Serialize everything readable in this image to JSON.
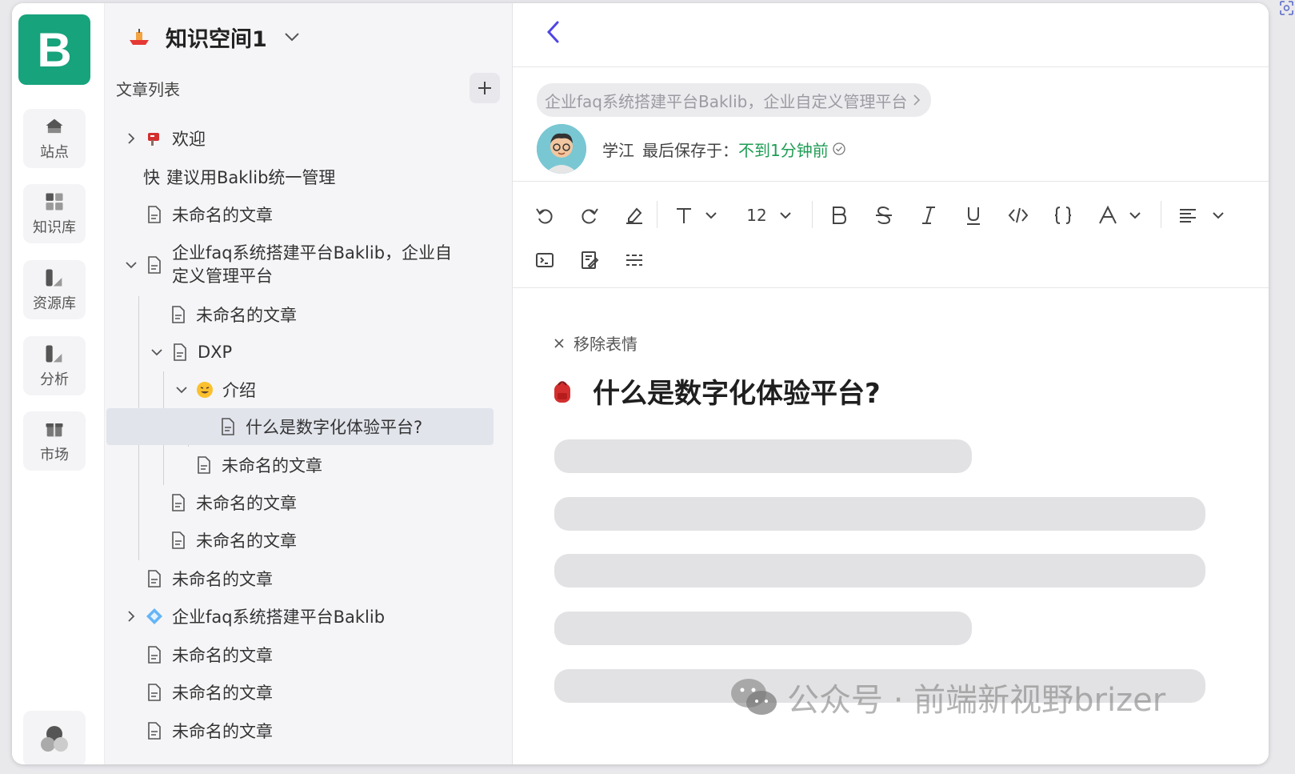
{
  "rail": {
    "logo": "B",
    "items": [
      {
        "label": "站点",
        "icon": "home-icon"
      },
      {
        "label": "知识库",
        "icon": "grid-icon"
      },
      {
        "label": "资源库",
        "icon": "resource-icon"
      },
      {
        "label": "分析",
        "icon": "analytics-icon"
      },
      {
        "label": "市场",
        "icon": "gift-icon"
      }
    ]
  },
  "sidebar": {
    "space_title": "知识空间1",
    "list_title": "文章列表",
    "tree": [
      {
        "label": "欢迎",
        "icon": "mailbox-icon"
      },
      {
        "prefix": "快",
        "label": "建议用Baklib统一管理"
      },
      {
        "label": "未命名的文章"
      },
      {
        "label_line1": "企业faq系统搭建平台Baklib，企业自",
        "label_line2": "定义管理平台"
      },
      {
        "label": "未命名的文章"
      },
      {
        "label": "DXP"
      },
      {
        "label": "介绍",
        "icon": "grin-emoji-icon"
      },
      {
        "label": "什么是数字化体验平台?"
      },
      {
        "label": "未命名的文章"
      },
      {
        "label": "未命名的文章"
      },
      {
        "label": "未命名的文章"
      },
      {
        "label": "未命名的文章"
      },
      {
        "label": "企业faq系统搭建平台Baklib",
        "icon": "diamond-icon"
      },
      {
        "label": "未命名的文章"
      },
      {
        "label": "未命名的文章"
      },
      {
        "label": "未命名的文章"
      }
    ]
  },
  "editor": {
    "breadcrumb": "企业faq系统搭建平台Baklib，企业自定义管理平台",
    "author": "学江",
    "saved_label": "最后保存于：",
    "saved_time": "不到1分钟前",
    "font_size": "12",
    "remove_emoji": "移除表情",
    "title": "什么是数字化体验平台?"
  },
  "watermark": "公众号 · 前端新视野brizer",
  "colors": {
    "brand": "#17a37c",
    "back_arrow": "#4f46e5",
    "saved_green": "#1f9d55",
    "selected_row": "#e2e4ec"
  }
}
